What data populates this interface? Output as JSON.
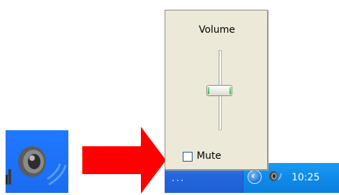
{
  "volume_popup": {
    "title": "Volume",
    "level": 0.5,
    "mute_label": "Mute",
    "mute_checked": false
  },
  "taskbar": {
    "overflow_label": "...",
    "clock": "10:25",
    "show_hidden_icon": "chevron-left-icon",
    "tray_icon": "speaker-icon"
  },
  "callout": {
    "arrow_color": "#ff0000",
    "icon": "speaker-icon"
  }
}
